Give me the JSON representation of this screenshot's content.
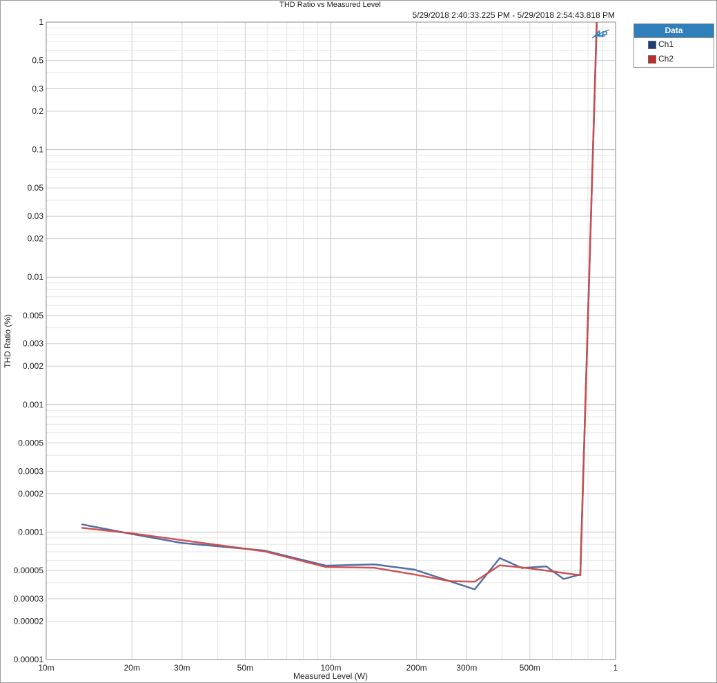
{
  "chart_data": {
    "type": "line",
    "title": "THD Ratio vs Measured Level",
    "subtitle": "5/29/2018 2:40:33.225 PM - 5/29/2018 2:54:43.818 PM",
    "xlabel": "Measured Level (W)",
    "ylabel": "THD Ratio (%)",
    "xscale": "log",
    "yscale": "log",
    "xlim": [
      0.01,
      1
    ],
    "ylim": [
      1e-05,
      1
    ],
    "grid": true,
    "legend_title": "Data",
    "legend_position": "top-right outside",
    "x_tick_labels": [
      "10m",
      "20m",
      "30m",
      "50m",
      "100m",
      "200m",
      "300m",
      "500m",
      "1"
    ],
    "x_tick_values": [
      0.01,
      0.02,
      0.03,
      0.05,
      0.1,
      0.2,
      0.3,
      0.5,
      1
    ],
    "y_tick_labels": [
      "1",
      "0.5",
      "0.3",
      "0.2",
      "0.1",
      "0.05",
      "0.03",
      "0.02",
      "0.01",
      "0.005",
      "0.003",
      "0.002",
      "0.001",
      "0.0005",
      "0.0003",
      "0.0002",
      "0.0001",
      "0.00005",
      "0.00003",
      "0.00002",
      "0.00001"
    ],
    "y_tick_values": [
      1,
      0.5,
      0.3,
      0.2,
      0.1,
      0.05,
      0.03,
      0.02,
      0.01,
      0.005,
      0.003,
      0.002,
      0.001,
      0.0005,
      0.0003,
      0.0002,
      0.0001,
      5e-05,
      3e-05,
      2e-05,
      1e-05
    ],
    "series": [
      {
        "name": "Ch1",
        "legend_color": "#1f3d7a",
        "line_color": "#4a66a0",
        "points": [
          [
            0.0133,
            0.000115
          ],
          [
            0.02,
            9.65e-05
          ],
          [
            0.03,
            8.2e-05
          ],
          [
            0.0585,
            7.15e-05
          ],
          [
            0.096,
            5.45e-05
          ],
          [
            0.142,
            5.58e-05
          ],
          [
            0.196,
            5.08e-05
          ],
          [
            0.32,
            3.55e-05
          ],
          [
            0.392,
            6.25e-05
          ],
          [
            0.469,
            5.22e-05
          ],
          [
            0.571,
            5.38e-05
          ],
          [
            0.657,
            4.28e-05
          ],
          [
            0.752,
            4.65e-05
          ],
          [
            0.86,
            1.1
          ]
        ]
      },
      {
        "name": "Ch2",
        "legend_color": "#c42a2a",
        "line_color": "#cc4b4b",
        "points": [
          [
            0.0133,
            0.000108
          ],
          [
            0.02,
            9.75e-05
          ],
          [
            0.0585,
            7.05e-05
          ],
          [
            0.096,
            5.32e-05
          ],
          [
            0.142,
            5.25e-05
          ],
          [
            0.196,
            4.65e-05
          ],
          [
            0.262,
            4.12e-05
          ],
          [
            0.32,
            4.08e-05
          ],
          [
            0.392,
            5.48e-05
          ],
          [
            0.469,
            5.28e-05
          ],
          [
            0.571,
            4.98e-05
          ],
          [
            0.752,
            4.58e-05
          ],
          [
            0.86,
            1.1
          ]
        ]
      }
    ]
  }
}
